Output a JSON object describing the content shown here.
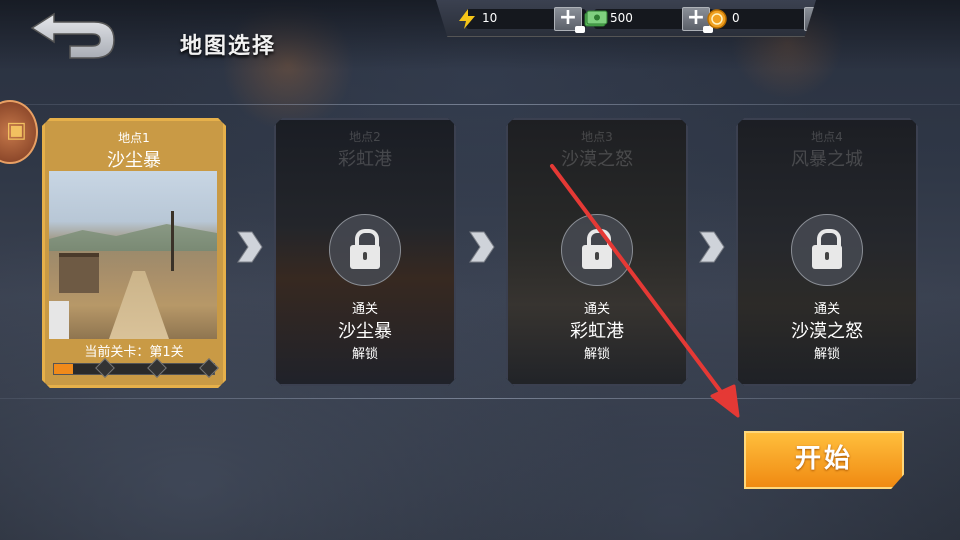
{
  "header": {
    "title": "地图选择",
    "back_icon": "back-arrow-icon"
  },
  "resources": [
    {
      "icon": "lightning-icon",
      "value": "10",
      "color": "#f5c518"
    },
    {
      "icon": "cash-icon",
      "value": "500",
      "color": "#4caf50"
    },
    {
      "icon": "coin-icon",
      "value": "0",
      "color": "#f0a020"
    }
  ],
  "maps": [
    {
      "num": "地点1",
      "name": "沙尘暴",
      "status": "current",
      "current_level_text": "当前关卡：第1关",
      "progress_fraction": 0.12
    },
    {
      "num": "地点2",
      "name": "彩虹港",
      "status": "locked",
      "unlock_prefix": "通关",
      "unlock_requirement": "沙尘暴",
      "unlock_suffix": "解锁"
    },
    {
      "num": "地点3",
      "name": "沙漠之怒",
      "status": "locked",
      "unlock_prefix": "通关",
      "unlock_requirement": "彩虹港",
      "unlock_suffix": "解锁"
    },
    {
      "num": "地点4",
      "name": "风暴之城",
      "status": "locked",
      "unlock_prefix": "通关",
      "unlock_requirement": "沙漠之怒",
      "unlock_suffix": "解锁"
    }
  ],
  "start_button": {
    "label": "开始"
  },
  "colors": {
    "accent": "#f09a1c",
    "active_border": "#e6b04a",
    "annotation_arrow": "#e53935"
  }
}
